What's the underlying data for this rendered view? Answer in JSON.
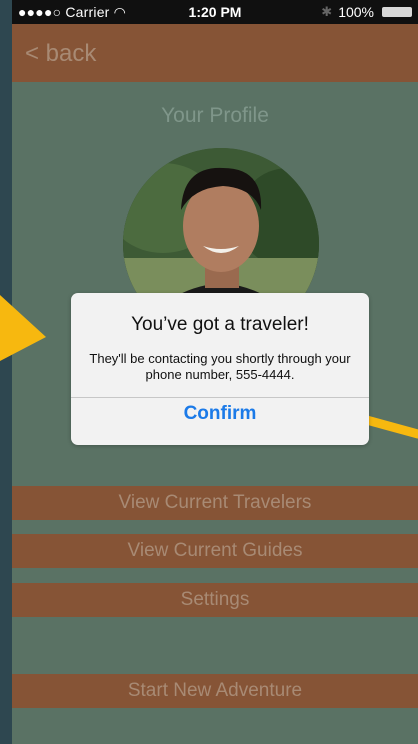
{
  "status_bar": {
    "carrier": "●●●●○ Carrier",
    "time": "1:20 PM",
    "battery": "100%"
  },
  "nav": {
    "back_label": "< back"
  },
  "profile": {
    "title": "Your Profile"
  },
  "alert": {
    "title": "You’ve got a traveler!",
    "message": "They'll be contacting you shortly through your phone number, 555-4444.",
    "confirm_label": "Confirm"
  },
  "menu": {
    "view_travelers": "View Current Travelers",
    "view_guides": "View Current Guides",
    "settings": "Settings",
    "start_adventure": "Start New Adventure"
  },
  "colors": {
    "accent_brown": "#865436",
    "background_green": "#5a7264",
    "alert_blue": "#1b7ae8",
    "arrow_yellow": "#f7b80f"
  }
}
